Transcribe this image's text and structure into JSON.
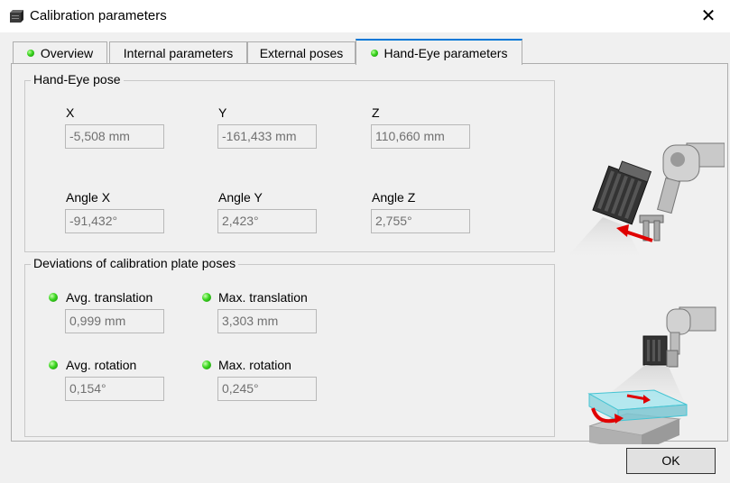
{
  "window": {
    "title": "Calibration parameters",
    "close_glyph": "✕"
  },
  "tabs": [
    {
      "label": "Overview",
      "status_dot": true
    },
    {
      "label": "Internal parameters",
      "status_dot": false
    },
    {
      "label": "External poses",
      "status_dot": false
    },
    {
      "label": "Hand-Eye parameters",
      "status_dot": true,
      "active": true
    }
  ],
  "hand_eye_pose": {
    "title": "Hand-Eye pose",
    "x": {
      "label": "X",
      "value": "-5,508 mm"
    },
    "y": {
      "label": "Y",
      "value": "-161,433 mm"
    },
    "z": {
      "label": "Z",
      "value": "110,660 mm"
    },
    "angle_x": {
      "label": "Angle X",
      "value": "-91,432°"
    },
    "angle_y": {
      "label": "Angle Y",
      "value": "2,423°"
    },
    "angle_z": {
      "label": "Angle Z",
      "value": "2,755°"
    }
  },
  "deviations": {
    "title": "Deviations of calibration plate poses",
    "avg_translation": {
      "label": "Avg. translation",
      "value": "0,999 mm"
    },
    "max_translation": {
      "label": "Max. translation",
      "value": "3,303 mm"
    },
    "avg_rotation": {
      "label": "Avg. rotation",
      "value": "0,154°"
    },
    "max_rotation": {
      "label": "Max. rotation",
      "value": "0,245°"
    }
  },
  "buttons": {
    "ok": "OK"
  },
  "colors": {
    "active_tab_accent": "#0078d7",
    "status_green": "#37d21c",
    "arrow_red": "#e00000",
    "plate_cyan": "#79e1ec"
  },
  "icons": {
    "app": "camera-box-icon",
    "close": "close-icon",
    "status": "green-status-dot-icon"
  }
}
